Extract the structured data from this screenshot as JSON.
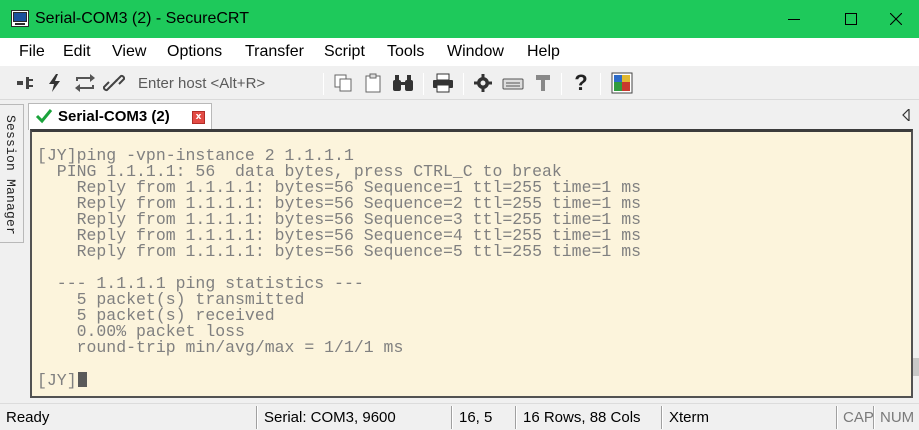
{
  "window": {
    "title": "Serial-COM3 (2) - SecureCRT",
    "title_bar_color": "#1ec95b",
    "controls": [
      "minimize-icon",
      "maximize-icon",
      "close-icon"
    ]
  },
  "menu": {
    "items": [
      "File",
      "Edit",
      "View",
      "Options",
      "Transfer",
      "Script",
      "Tools",
      "Window",
      "Help"
    ]
  },
  "toolbar": {
    "host_placeholder": "Enter host <Alt+R>",
    "left_icons": [
      "connect-icon",
      "quick-connect-icon",
      "reconnect-icon",
      "disconnect-icon"
    ],
    "right_icons": [
      "copy-icon",
      "paste-icon",
      "find-icon",
      "print-icon",
      "settings-icon",
      "keymap-icon",
      "sftp-icon",
      "help-icon",
      "about-icon"
    ]
  },
  "sidebar": {
    "session_manager_label": "Session Manager"
  },
  "tabs": [
    {
      "label": "Serial-COM3 (2)",
      "status": "connected",
      "close_label": "x"
    }
  ],
  "terminal": {
    "background": "#fcf4dc",
    "text_color": "#808080",
    "lines": [
      "",
      "[JY]ping -vpn-instance 2 1.1.1.1",
      "  PING 1.1.1.1: 56  data bytes, press CTRL_C to break",
      "    Reply from 1.1.1.1: bytes=56 Sequence=1 ttl=255 time=1 ms",
      "    Reply from 1.1.1.1: bytes=56 Sequence=2 ttl=255 time=1 ms",
      "    Reply from 1.1.1.1: bytes=56 Sequence=3 ttl=255 time=1 ms",
      "    Reply from 1.1.1.1: bytes=56 Sequence=4 ttl=255 time=1 ms",
      "    Reply from 1.1.1.1: bytes=56 Sequence=5 ttl=255 time=1 ms",
      "",
      "  --- 1.1.1.1 ping statistics ---",
      "    5 packet(s) transmitted",
      "    5 packet(s) received",
      "    0.00% packet loss",
      "    round-trip min/avg/max = 1/1/1 ms",
      "",
      "[JY]"
    ]
  },
  "status": {
    "state": "Ready",
    "connection": "Serial: COM3, 9600",
    "cursor_position": "16,  5",
    "size": "16 Rows, 88 Cols",
    "emulation": "Xterm",
    "caps": "CAP",
    "num": "NUM"
  }
}
